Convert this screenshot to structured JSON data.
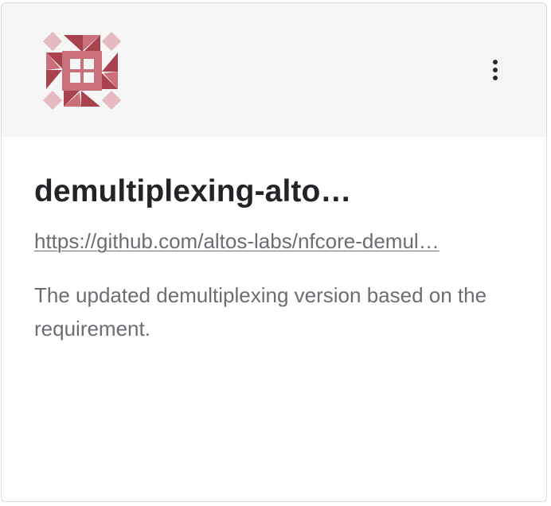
{
  "card": {
    "title": "demultiplexing-alto…",
    "repo_url": "https://github.com/altos-labs/nfcore-demul…",
    "description": "The updated demultiplexing version based on the requirement."
  },
  "avatar": {
    "icon": "identicon-icon",
    "colors": {
      "dark": "#a8424f",
      "medium": "#c9707b",
      "light": "#e6b8bf"
    }
  },
  "menu": {
    "icon": "kebab-menu-icon"
  },
  "colors": {
    "header_bg": "#f5f5f5",
    "title": "#222428",
    "muted_text": "#6a6e73",
    "border": "#dcdcdc"
  }
}
